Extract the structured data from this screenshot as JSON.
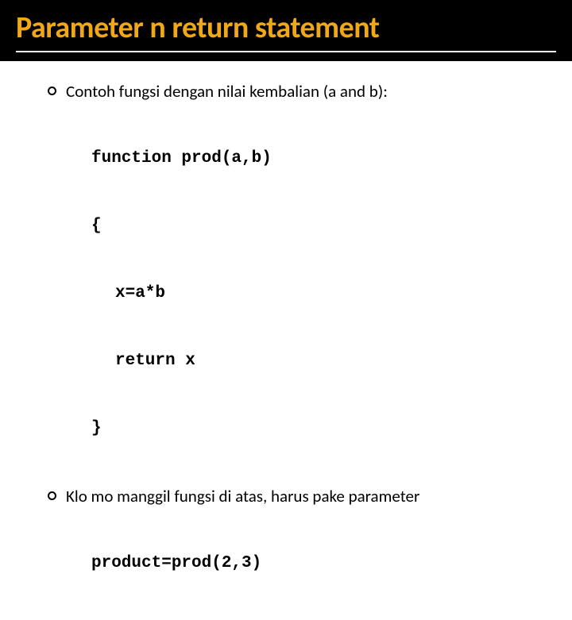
{
  "title": "Parameter n return statement",
  "bullets": {
    "b1": "Contoh fungsi dengan nilai kembalian  (a and b):",
    "b2": "Klo mo manggil fungsi di atas, harus pake parameter"
  },
  "code": {
    "l1": "function prod(a,b)",
    "l2": "{",
    "l3": "x=a*b",
    "l4": "return x",
    "l5": "}",
    "call": "product=prod(2,3)"
  }
}
